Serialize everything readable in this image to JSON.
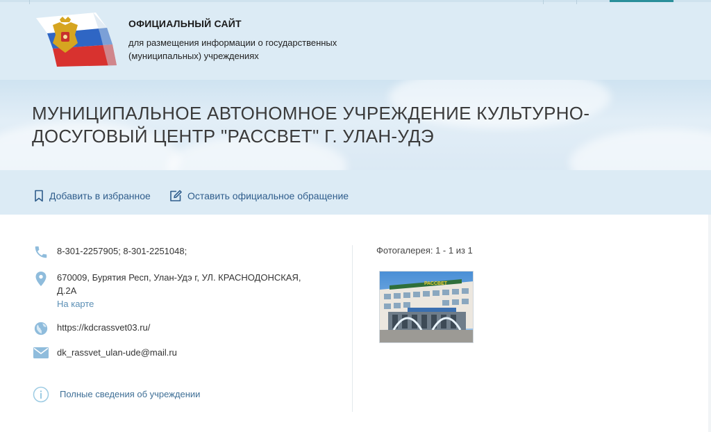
{
  "header": {
    "title": "ОФИЦИАЛЬНЫЙ САЙТ",
    "subtitle": "для размещения информации о государственных (муниципальных) учреждениях",
    "accent": "#2a8f9a"
  },
  "organization": {
    "name": "МУНИЦИПАЛЬНОЕ АВТОНОМНОЕ УЧРЕЖДЕНИЕ КУЛЬТУРНО-ДОСУГОВЫЙ ЦЕНТР \"РАССВЕТ\" Г. УЛАН-УДЭ"
  },
  "actions": {
    "favorite_label": "Добавить в избранное",
    "appeal_label": "Оставить официальное обращение"
  },
  "contacts": {
    "phone": "8-301-2257905; 8-301-2251048;",
    "address": "670009, Бурятия Респ, Улан-Удэ г, УЛ. КРАСНОДОНСКАЯ, Д.2А",
    "map_link": "На карте",
    "website": "https://kdcrassvet03.ru/",
    "email": "dk_rassvet_ulan-ude@mail.ru",
    "full_info_link": "Полные сведения об учреждении"
  },
  "gallery": {
    "label": "Фотогалерея: 1 - 1 из 1",
    "building_sign": "РАССВЕТ"
  },
  "icons": {
    "phone": "phone-icon",
    "location": "location-pin-icon",
    "globe": "globe-icon",
    "mail": "mail-icon",
    "info": "info-icon",
    "bookmark": "bookmark-icon",
    "edit": "edit-icon"
  },
  "colors": {
    "header_bg": "#dcebf5",
    "link": "#3d82b4",
    "action_text": "#2f5d8c",
    "icon": "#8fbcdc"
  }
}
